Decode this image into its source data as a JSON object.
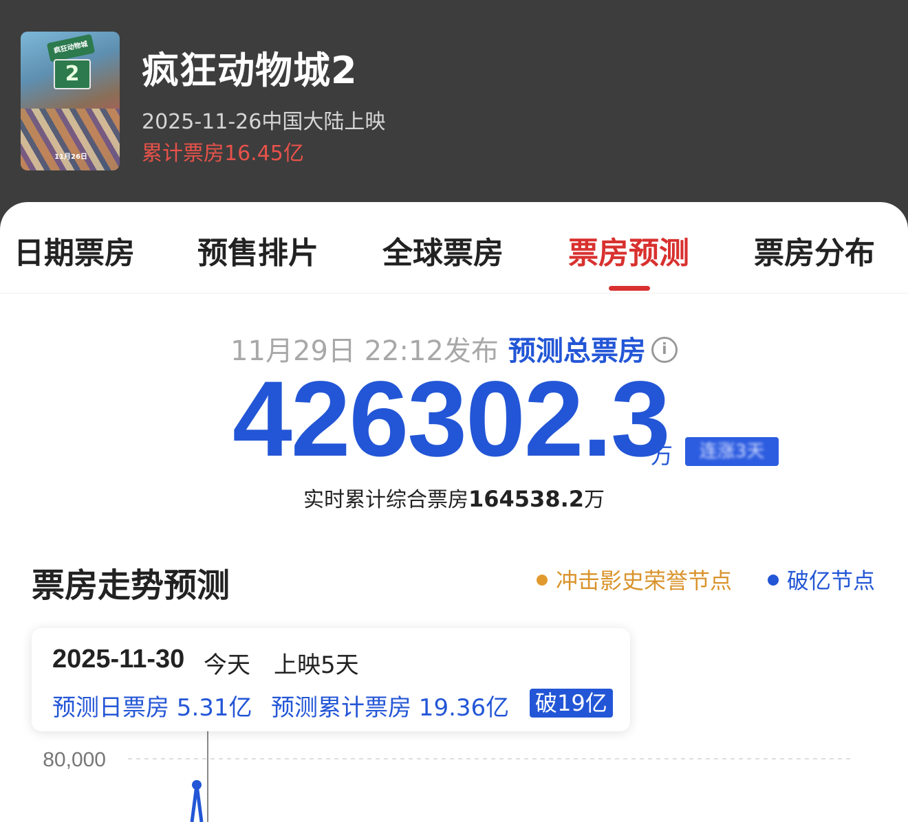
{
  "header": {
    "poster": {
      "sign_text": "疯狂动物城",
      "number": "2",
      "date_text": "11月26日"
    },
    "title": "疯狂动物城2",
    "release": "2025-11-26中国大陆上映",
    "cumulative_gross": "累计票房16.45亿"
  },
  "tabs": [
    {
      "label": "日期票房",
      "active": false
    },
    {
      "label": "预售排片",
      "active": false
    },
    {
      "label": "全球票房",
      "active": false
    },
    {
      "label": "票房预测",
      "active": true
    },
    {
      "label": "票房分布",
      "active": false
    }
  ],
  "forecast": {
    "publish_time": "11月29日 22:12发布",
    "label": "预测总票房",
    "info_icon": "info-icon",
    "value": "426302.3",
    "unit": "万",
    "rise_badge": "连涨3天",
    "realtime_label": "实时累计综合票房",
    "realtime_value": "164538.2",
    "realtime_unit": "万"
  },
  "trend": {
    "title": "票房走势预测",
    "legend": [
      {
        "label": "冲击影史荣誉节点",
        "color": "#e09a2e"
      },
      {
        "label": "破亿节点",
        "color": "#2356d6"
      }
    ]
  },
  "tooltip": {
    "date": "2025-11-30",
    "today": "今天",
    "days": "上映5天",
    "day_pred": "预测日票房 5.31亿",
    "cum_pred": "预测累计票房 19.36亿",
    "badge": "破19亿"
  },
  "chart_data": {
    "type": "line",
    "y_tick_labels": [
      "80,000"
    ],
    "y_ticks": [
      80000
    ],
    "colors": {
      "series": "#2356d6",
      "gridline": "#dddddd",
      "cursor": "#888888"
    }
  }
}
